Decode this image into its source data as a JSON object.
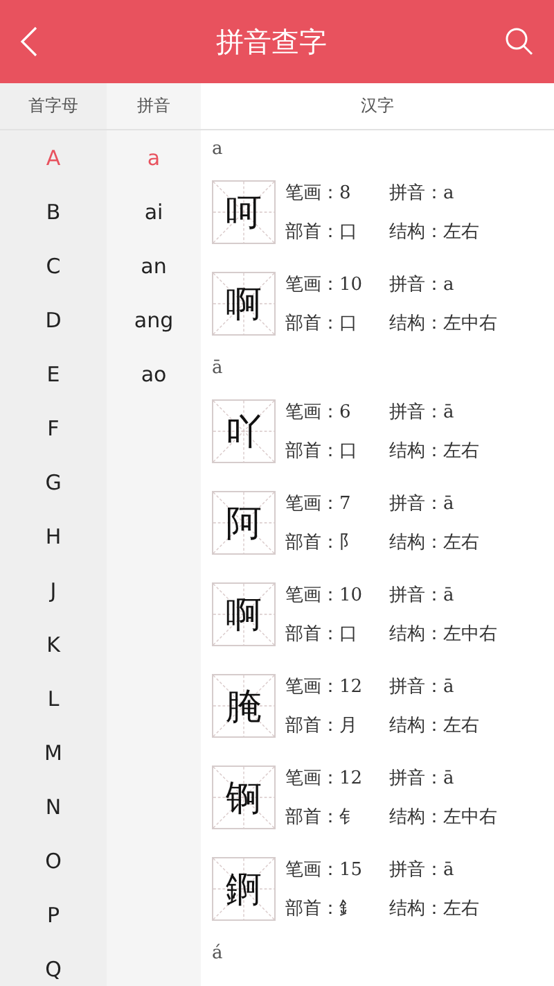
{
  "header": {
    "title": "拼音查字"
  },
  "column_heads": {
    "initials": "首字母",
    "pinyin": "拼音",
    "hanzi": "汉字"
  },
  "initials": [
    {
      "label": "A",
      "selected": true
    },
    {
      "label": "B",
      "selected": false
    },
    {
      "label": "C",
      "selected": false
    },
    {
      "label": "D",
      "selected": false
    },
    {
      "label": "E",
      "selected": false
    },
    {
      "label": "F",
      "selected": false
    },
    {
      "label": "G",
      "selected": false
    },
    {
      "label": "H",
      "selected": false
    },
    {
      "label": "J",
      "selected": false
    },
    {
      "label": "K",
      "selected": false
    },
    {
      "label": "L",
      "selected": false
    },
    {
      "label": "M",
      "selected": false
    },
    {
      "label": "N",
      "selected": false
    },
    {
      "label": "O",
      "selected": false
    },
    {
      "label": "P",
      "selected": false
    },
    {
      "label": "Q",
      "selected": false
    }
  ],
  "pinyin": [
    {
      "label": "a",
      "selected": true
    },
    {
      "label": "ai",
      "selected": false
    },
    {
      "label": "an",
      "selected": false
    },
    {
      "label": "ang",
      "selected": false
    },
    {
      "label": "ao",
      "selected": false
    }
  ],
  "groups": [
    {
      "heading": "a",
      "characters": [
        {
          "character": "呵",
          "strokes": "笔画：8",
          "pinyin": "拼音：a",
          "radical": "部首：口",
          "structure": "结构：左右"
        },
        {
          "character": "啊",
          "strokes": "笔画：10",
          "pinyin": "拼音：a",
          "radical": "部首：口",
          "structure": "结构：左中右"
        }
      ]
    },
    {
      "heading": "ā",
      "characters": [
        {
          "character": "吖",
          "strokes": "笔画：6",
          "pinyin": "拼音：ā",
          "radical": "部首：口",
          "structure": "结构：左右"
        },
        {
          "character": "阿",
          "strokes": "笔画：7",
          "pinyin": "拼音：ā",
          "radical": "部首：阝",
          "structure": "结构：左右"
        },
        {
          "character": "啊",
          "strokes": "笔画：10",
          "pinyin": "拼音：ā",
          "radical": "部首：口",
          "structure": "结构：左中右"
        },
        {
          "character": "腌",
          "strokes": "笔画：12",
          "pinyin": "拼音：ā",
          "radical": "部首：月",
          "structure": "结构：左右"
        },
        {
          "character": "锕",
          "strokes": "笔画：12",
          "pinyin": "拼音：ā",
          "radical": "部首：钅",
          "structure": "结构：左中右"
        },
        {
          "character": "錒",
          "strokes": "笔画：15",
          "pinyin": "拼音：ā",
          "radical": "部首：釒",
          "structure": "结构：左右"
        }
      ]
    },
    {
      "heading": "á"
    }
  ]
}
